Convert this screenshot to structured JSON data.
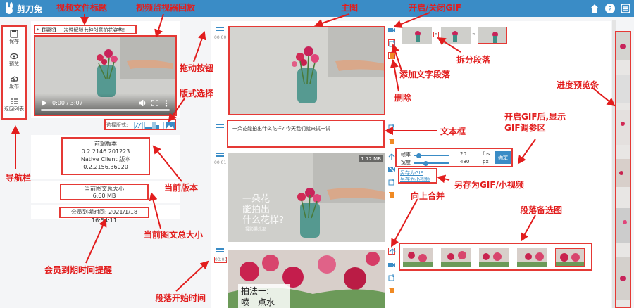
{
  "app": {
    "name": "剪刀兔",
    "icons": [
      "home-icon",
      "help-icon",
      "list-icon"
    ]
  },
  "nav": [
    {
      "label": "保存",
      "icon": "save-icon"
    },
    {
      "label": "预览",
      "icon": "eye-icon"
    },
    {
      "label": "发布",
      "icon": "upload-icon"
    },
    {
      "label": "返回列表",
      "icon": "list-back-icon"
    }
  ],
  "file_title": "*【摄影】一次性解锁七种创意拍花姿势!",
  "video": {
    "time": "0:00 / 3:07"
  },
  "layout": {
    "label": "选择版式:"
  },
  "versions": {
    "front_label": "前端版本",
    "front": "0.2.2146.201223",
    "native_label": "Native Client 版本",
    "native": "0.2.2156.36020"
  },
  "size": {
    "label": "当前图文总大小",
    "value": "6.60 MB"
  },
  "vip": "会员到期时间:  2021/1/18 16:54:11",
  "segments": {
    "ts1": "00:00",
    "ts2": "00:01",
    "ts3": "00:06",
    "text1": "一朵花能拍出什么花样? 今天我们就来试一试",
    "badge": "1.72 MB",
    "overlay": "一朵花\n能拍出\n什么花样?",
    "overlay_small": "摄影俱乐部",
    "bottom_caption": "拍法一:\n喷一点水"
  },
  "gif": {
    "rate_label": "帧率",
    "rate": "20",
    "rate_unit": "fps",
    "width_label": "宽度",
    "width": "480",
    "width_unit": "px",
    "ok": "确定",
    "rate_level": 0.15,
    "width_level": 0.35
  },
  "save": {
    "gif": "另存为GIF",
    "video": "另存为小视频"
  },
  "annotations": {
    "nav": "导航栏",
    "title": "视频文件标题",
    "monitor": "视频监视器回放",
    "drag": "拖动按钮",
    "layout": "版式选择",
    "version": "当前版本",
    "size": "当前图文总大小",
    "vip": "会员到期时间提醒",
    "segtime": "段落开始时间",
    "main": "主图",
    "textbox": "文本框",
    "togglegif": "开启/关闭GIF",
    "split": "拆分段落",
    "addtext": "添加文字段落",
    "delete": "删除",
    "gifhint": "开启GIF后,显示\nGIF调参区",
    "saveas": "另存为GIF/小视频",
    "merge": "向上合并",
    "cands": "段落备选图",
    "progress": "进度预览条"
  }
}
